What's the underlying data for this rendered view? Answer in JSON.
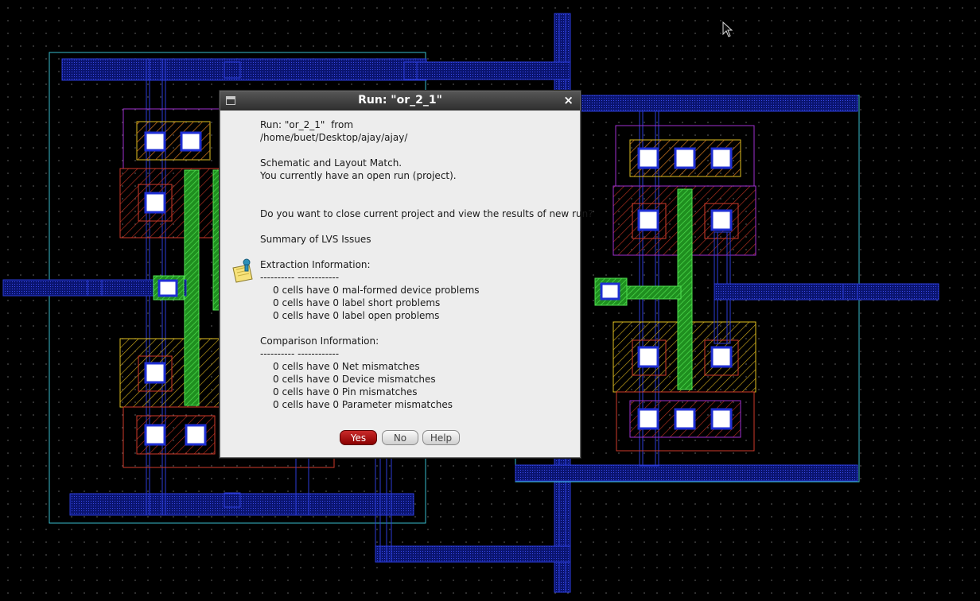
{
  "dialog": {
    "title": "Run: \"or_2_1\"",
    "lines": [
      "Run: \"or_2_1\"  from",
      "/home/buet/Desktop/ajay/ajay/",
      "",
      "Schematic and Layout Match.",
      "You currently have an open run (project).",
      "",
      "",
      "Do you want to close current project and view the results of new run?",
      "",
      "Summary of LVS Issues",
      "",
      "Extraction Information:",
      "---------- ------------",
      "0 cells have 0 mal-formed device problems",
      "0 cells have 0 label short problems",
      "0 cells have 0 label open problems",
      "",
      "Comparison Information:",
      "---------- ------------",
      "0 cells have 0 Net mismatches",
      "0 cells have 0 Device mismatches",
      "0 cells have 0 Pin mismatches",
      "0 cells have 0 Parameter mismatches"
    ],
    "buttons": {
      "yes": "Yes",
      "no": "No",
      "help": "Help"
    },
    "close_glyph": "×"
  },
  "icons": {
    "window_menu": "window-menu-icon",
    "message": "note-info-icon",
    "cursor": "mouse-pointer-icon"
  },
  "colors": {
    "metal1": "#1f2fd4",
    "nwell": "#3dc6d6",
    "poly": "#2ecc2e",
    "pdiff": "#d03a2a",
    "ndiff": "#e0c020",
    "implant": "#a030d0",
    "contact": "#ffffff",
    "yes_button": "#a80f0f"
  }
}
